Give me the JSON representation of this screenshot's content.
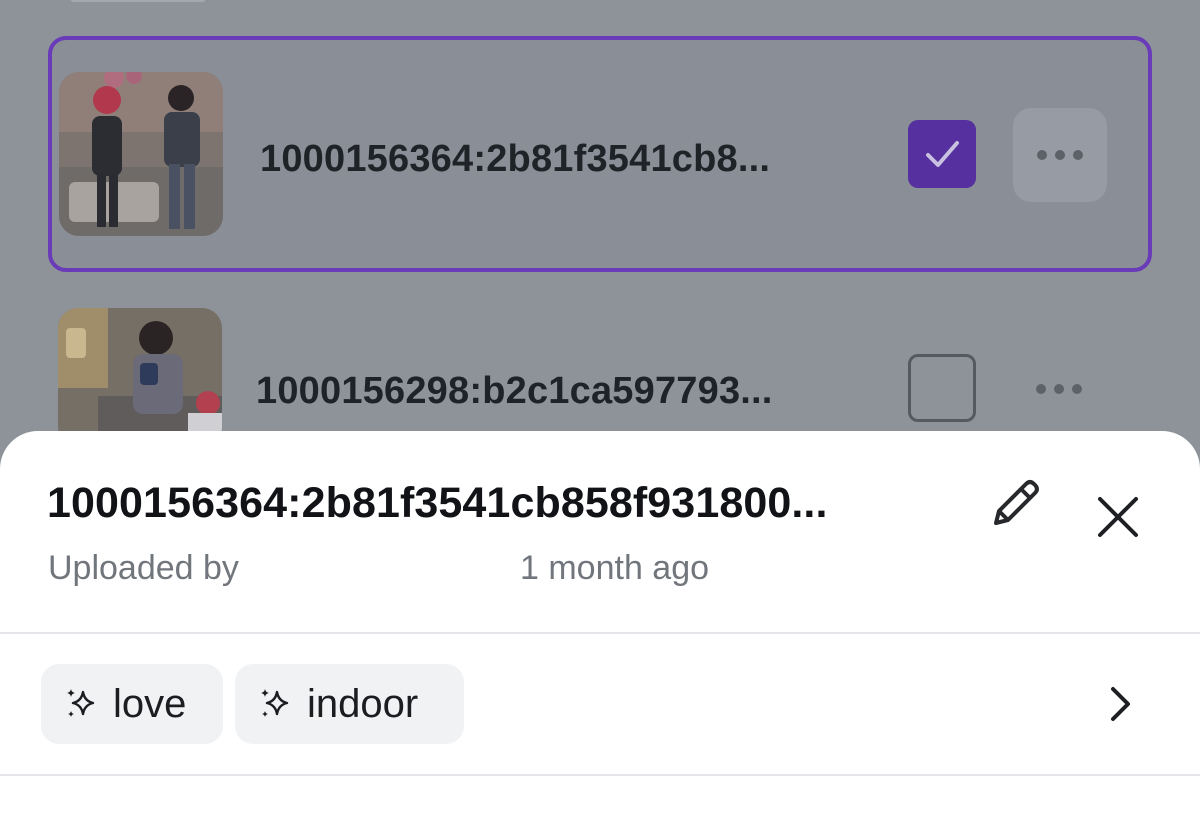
{
  "list": {
    "items": [
      {
        "filename": "1000156364:2b81f3541cb8...",
        "selected": true,
        "thumbnail_icon": "photo-two-people-red-hair"
      },
      {
        "filename": "1000156298:b2c1ca597793...",
        "selected": false,
        "thumbnail_icon": "photo-people-indoor"
      }
    ]
  },
  "sheet": {
    "title": "1000156364:2b81f3541cb858f931800...",
    "uploaded_by_label": "Uploaded by",
    "time_ago": "1 month ago",
    "edit_icon": "pencil-icon",
    "close_icon": "close-icon",
    "tags": [
      {
        "label": "love",
        "icon": "sparkle-icon"
      },
      {
        "label": "indoor",
        "icon": "sparkle-icon"
      }
    ],
    "tags_chevron_icon": "chevron-right-icon"
  },
  "colors": {
    "accent": "#6a3bb9",
    "checkbox_fill": "#55309e",
    "overlay": "#8e939a",
    "sheet_bg": "#ffffff"
  }
}
